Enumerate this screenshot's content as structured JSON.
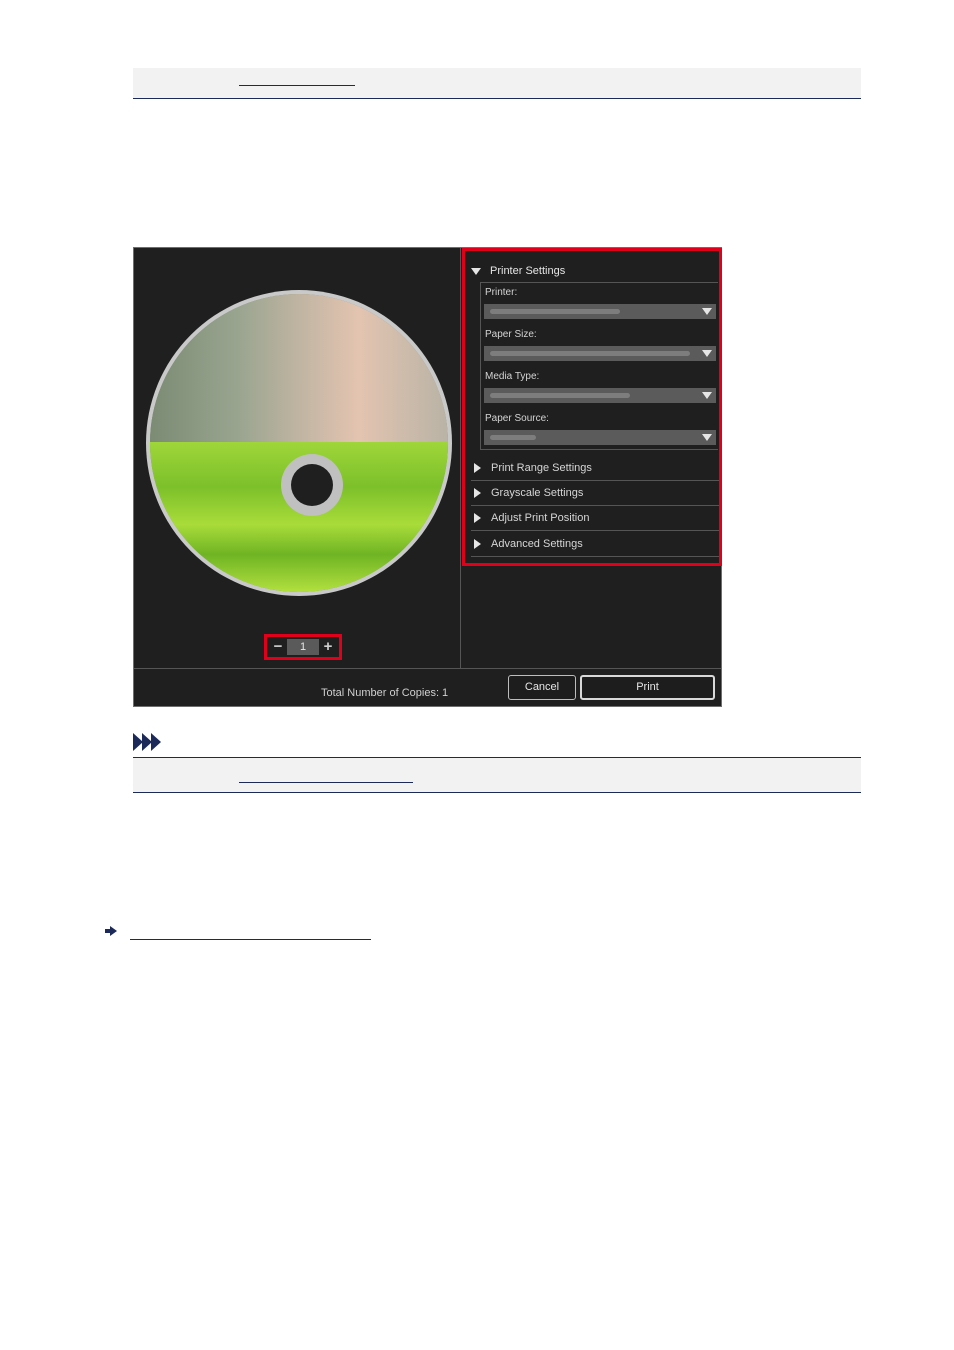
{
  "dialog": {
    "printer_settings": {
      "heading": "Printer Settings",
      "fields": [
        {
          "label": "Printer:"
        },
        {
          "label": "Paper Size:"
        },
        {
          "label": "Media Type:"
        },
        {
          "label": "Paper Source:"
        }
      ]
    },
    "sections": [
      {
        "label": "Print Range Settings"
      },
      {
        "label": "Grayscale Settings"
      },
      {
        "label": "Adjust Print Position"
      },
      {
        "label": "Advanced Settings"
      }
    ],
    "copies": {
      "decrement": "−",
      "value": "1",
      "increment": "+"
    },
    "footer": {
      "total_copies": "Total Number of Copies:  1",
      "cancel_label": "Cancel",
      "print_label": "Print"
    }
  },
  "icons": [
    "triangle-down-icon",
    "triangle-right-icon",
    "note-chevron-icon",
    "arrow-right-icon"
  ]
}
